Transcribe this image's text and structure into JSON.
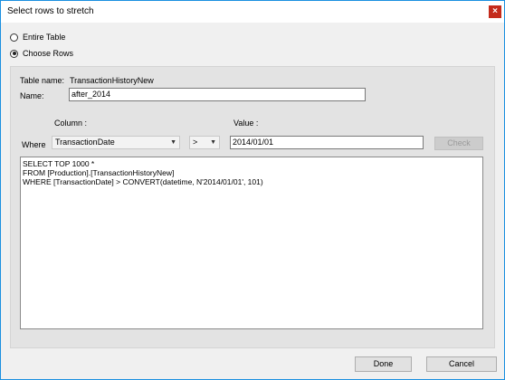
{
  "window": {
    "title": "Select rows to stretch",
    "close_glyph": "×"
  },
  "options": {
    "entire_table": "Entire Table",
    "choose_rows": "Choose Rows",
    "selected": "choose_rows"
  },
  "table": {
    "table_name_label": "Table name:",
    "table_name_value": "TransactionHistoryNew",
    "name_label": "Name:",
    "name_value": "after_2014"
  },
  "filter": {
    "column_header": "Column :",
    "value_header": "Value :",
    "where_label": "Where",
    "column_value": "TransactionDate",
    "operator_value": ">",
    "value_input": "2014/01/01",
    "check_button": "Check",
    "dropdown_glyph": "▼"
  },
  "sql": {
    "lines": [
      "SELECT TOP 1000 *",
      "FROM [Production].[TransactionHistoryNew]",
      "WHERE [TransactionDate] > CONVERT(datetime, N'2014/01/01', 101)"
    ]
  },
  "footer": {
    "done_button": "Done",
    "cancel_button": "Cancel"
  }
}
